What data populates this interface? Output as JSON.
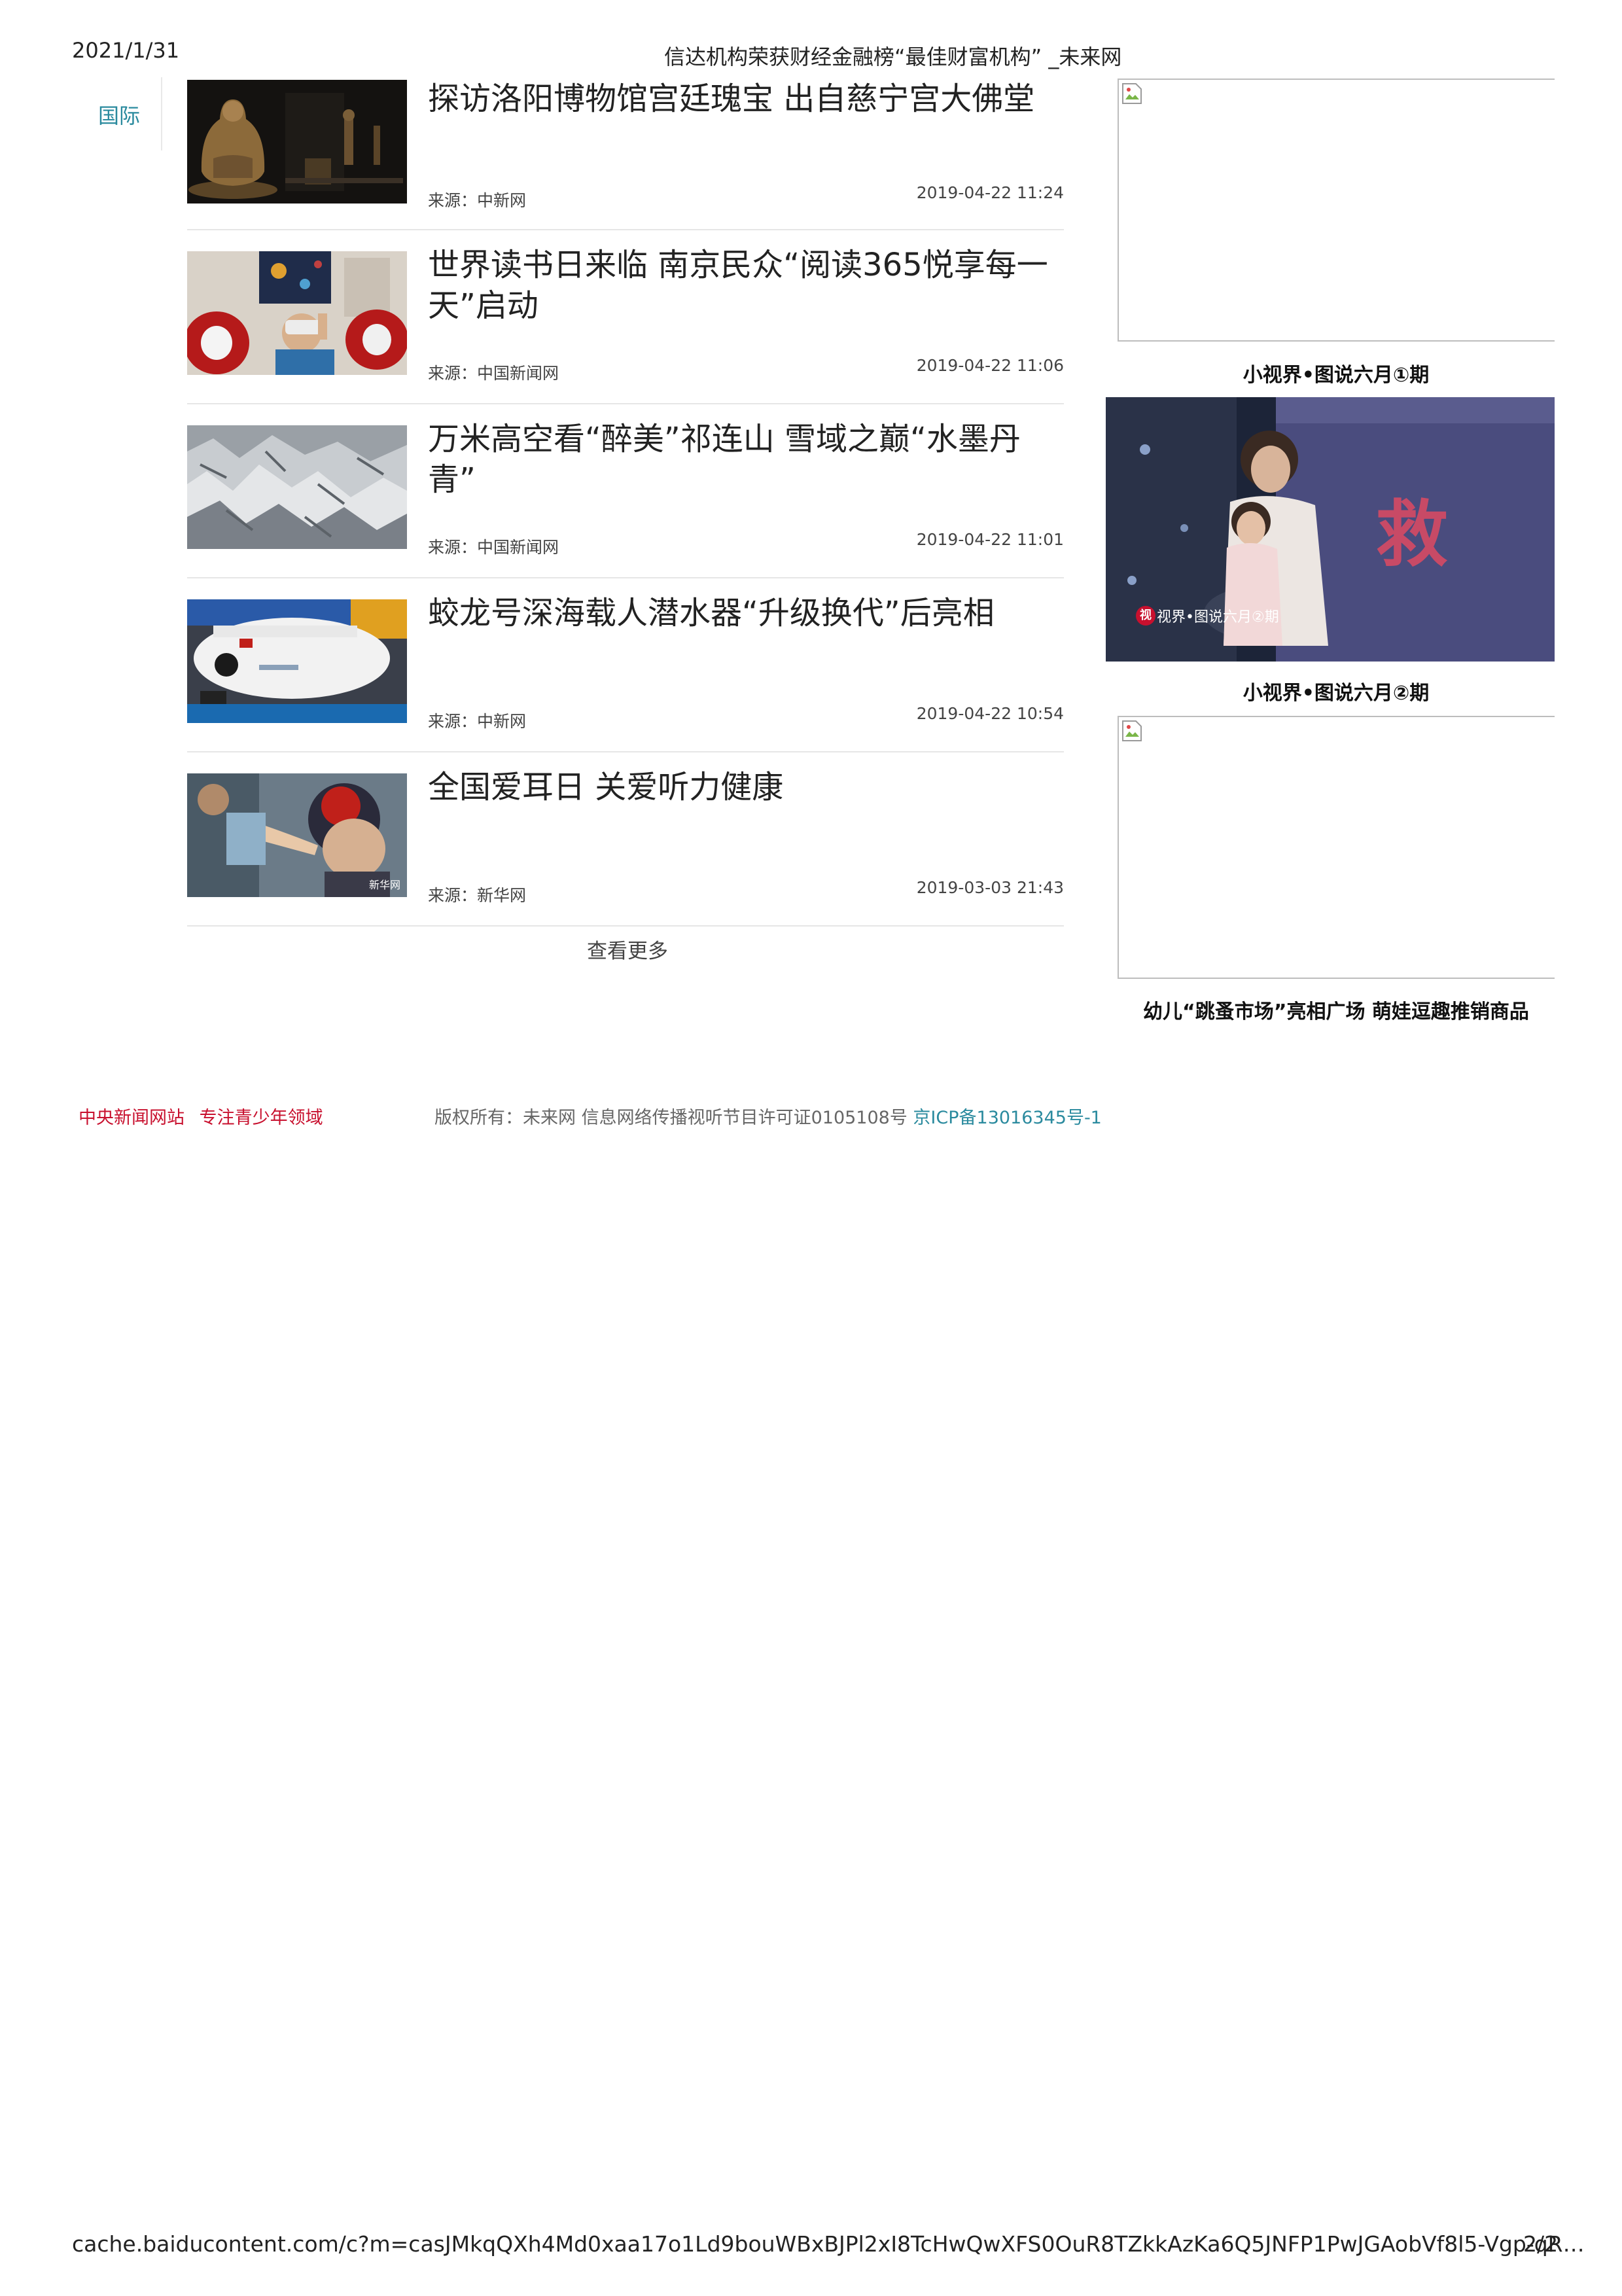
{
  "print_header": {
    "date": "2021/1/31",
    "title": "信达机构荣获财经金融榜“最佳财富机构” _未来网"
  },
  "nav": {
    "category": "国际"
  },
  "news": [
    {
      "title": "探访洛阳博物馆宫廷瑰宝 出自慈宁宫大佛堂",
      "source": "来源：中新网",
      "date": "2019-04-22 11:24",
      "thumb": "buddha-statue-photo"
    },
    {
      "title": "世界读书日来临 南京民众“阅读365悦享每一天”启动",
      "source": "来源：中国新闻网",
      "date": "2019-04-22 11:06",
      "thumb": "vr-reading-photo"
    },
    {
      "title": "万米高空看“醉美”祁连山 雪域之巅“水墨丹青”",
      "source": "来源：中国新闻网",
      "date": "2019-04-22 11:01",
      "thumb": "snow-mountain-photo"
    },
    {
      "title": "蛟龙号深海载人潜水器“升级换代”后亮相",
      "source": "来源：中新网",
      "date": "2019-04-22 10:54",
      "thumb": "submersible-photo"
    },
    {
      "title": "全国爱耳日 关爱听力健康",
      "source": "来源：新华网",
      "date": "2019-03-03 21:43",
      "thumb": "ear-exam-photo",
      "watermark": "新华网"
    }
  ],
  "more_label": "查看更多",
  "sidebar": [
    {
      "caption": "小视界•图说六月①期",
      "image": "broken-image"
    },
    {
      "caption": "小视界•图说六月②期",
      "image": "rescue-photo",
      "banner_char": "救",
      "overlay_text": "视界•图说六月②期",
      "overlay_badge": "视"
    },
    {
      "caption": "幼儿“跳蚤市场”亮相广场 萌娃逗趣推销商品",
      "image": "broken-image"
    }
  ],
  "footer": {
    "left_items": [
      "中央新闻网站",
      "专注青少年领域"
    ],
    "copyright": "版权所有：未来网 信息网络传播视听节目许可证0105108号 ",
    "icp": "京ICP备13016345号-1"
  },
  "print_footer": {
    "url": "cache.baiducontent.com/c?m=casJMkqQXh4Md0xaa17o1Ld9bouWBxBJPl2xI8TcHwQwXFS0OuR8TZkkAzKa6Q5JNFP1PwJGAobVf8l5-Vgp-qR…",
    "page": "2/2"
  },
  "colors": {
    "accent": "#2a8a9e",
    "footer_red": "#c8102e"
  }
}
